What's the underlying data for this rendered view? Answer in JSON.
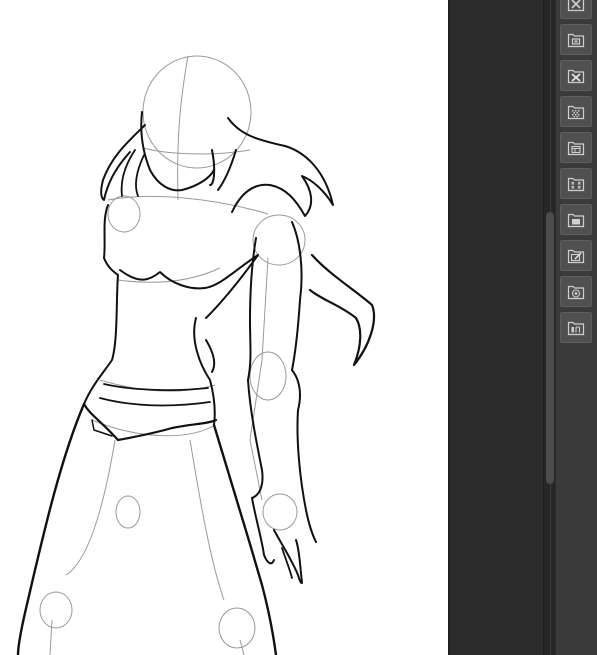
{
  "canvas": {
    "background": "#ffffff",
    "subject": "sketch-figure"
  },
  "colors": {
    "panel": "#2b2b2b",
    "toolbar": "#3a3a3a",
    "button": "#505050",
    "icon": "#cfcfcf"
  },
  "layers_panel": {
    "scrollbar_thumb_color": "#4b4b4b"
  },
  "toolbar": {
    "buttons": [
      {
        "icon": "delete-layer-icon"
      },
      {
        "icon": "new-layer-folder-icon"
      },
      {
        "icon": "delete-layer-icon"
      },
      {
        "icon": "mask-layer-icon"
      },
      {
        "icon": "paper-layer-icon"
      },
      {
        "icon": "transform-layer-icon"
      },
      {
        "icon": "new-raster-layer-icon"
      },
      {
        "icon": "edit-layer-icon"
      },
      {
        "icon": "layer-property-icon"
      },
      {
        "icon": "reference-layer-icon"
      }
    ]
  }
}
